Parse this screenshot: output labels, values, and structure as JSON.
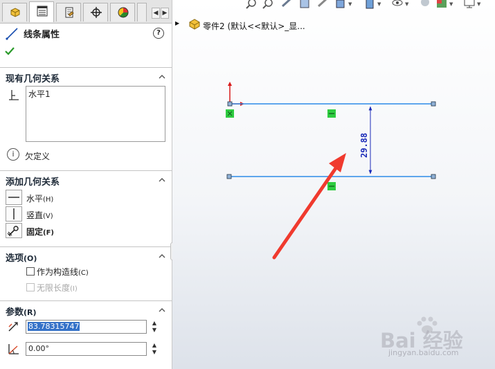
{
  "property_manager": {
    "tabs": [
      {
        "name": "featuremanager-tab",
        "icon": "featuremanager-icon"
      },
      {
        "name": "propertymanager-tab",
        "icon": "propertymanager-icon",
        "active": true
      },
      {
        "name": "configurationmanager-tab",
        "icon": "configurationmanager-icon"
      },
      {
        "name": "dimxpert-tab",
        "icon": "crosshair-icon"
      },
      {
        "name": "display-manager-tab",
        "icon": "appearance-sphere-icon"
      }
    ],
    "title": "线条属性",
    "help": "?",
    "existing_relations": {
      "header": "现有几何关系",
      "items": [
        "水平1"
      ],
      "status": "欠定义"
    },
    "add_relations": {
      "header": "添加几何关系",
      "items": [
        {
          "label": "水平",
          "mnemonic": "(H)",
          "icon": "horizontal-relation-icon"
        },
        {
          "label": "竖直",
          "mnemonic": "(V)",
          "icon": "vertical-relation-icon"
        },
        {
          "label": "固定",
          "mnemonic": "(F)",
          "icon": "fix-anchor-icon",
          "bold": true
        }
      ]
    },
    "options": {
      "header": "选项",
      "mnemonic": "(O)",
      "construction": {
        "label": "作为构造线",
        "mnemonic": "(C)",
        "checked": false
      },
      "infinite": {
        "label": "无限长度",
        "mnemonic": "(I)",
        "checked": false,
        "disabled": true
      }
    },
    "parameters": {
      "header": "参数",
      "mnemonic": "(R)",
      "length": "83.78315747",
      "angle": "0.00°"
    }
  },
  "graphics": {
    "tree_label": "零件2  (默认<<默认>_显...",
    "dimension": "29.88"
  },
  "watermark": {
    "brand": "Bai 经验",
    "url": "jingyan.baidu.com"
  },
  "colors": {
    "sketch_line": "#2b8ae8",
    "dimension": "#1a2ab8",
    "arrow": "#f03a2e",
    "relation": "#2ecc40",
    "origin": "#d81b1b",
    "selection": "#3572c8"
  }
}
